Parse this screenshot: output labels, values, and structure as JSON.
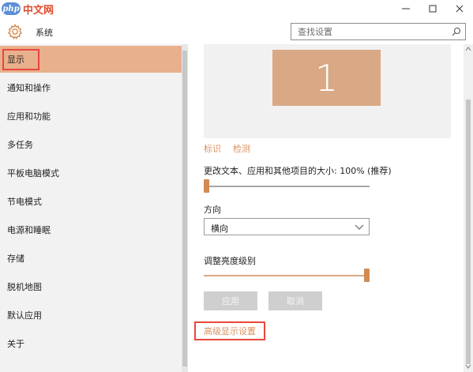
{
  "watermark": {
    "badge": "php",
    "text": "中文网"
  },
  "window": {
    "minimize_icon": "minimize-icon",
    "maximize_icon": "maximize-icon",
    "close_icon": "close-icon"
  },
  "header": {
    "title": "系统",
    "search_placeholder": "查找设置"
  },
  "sidebar": {
    "items": [
      {
        "label": "显示",
        "active": true
      },
      {
        "label": "通知和操作"
      },
      {
        "label": "应用和功能"
      },
      {
        "label": "多任务"
      },
      {
        "label": "平板电脑模式"
      },
      {
        "label": "节电模式"
      },
      {
        "label": "电源和睡眠"
      },
      {
        "label": "存储"
      },
      {
        "label": "脱机地图"
      },
      {
        "label": "默认应用"
      },
      {
        "label": "关于"
      }
    ]
  },
  "main": {
    "monitor_number": "1",
    "identify_link": "标识",
    "detect_link": "检测",
    "scale_label": "更改文本、应用和其他项目的大小: 100% (推荐)",
    "scale_value_percent": 0,
    "orientation_label": "方向",
    "orientation_value": "横向",
    "brightness_label": "调整亮度级别",
    "brightness_value_percent": 100,
    "apply_button": "应用",
    "cancel_button": "取消",
    "advanced_link": "高级显示设置"
  },
  "colors": {
    "accent": "#d9a985",
    "active_item": "#e8b08c",
    "highlight_box": "#e8473d",
    "link": "#d9905e"
  }
}
